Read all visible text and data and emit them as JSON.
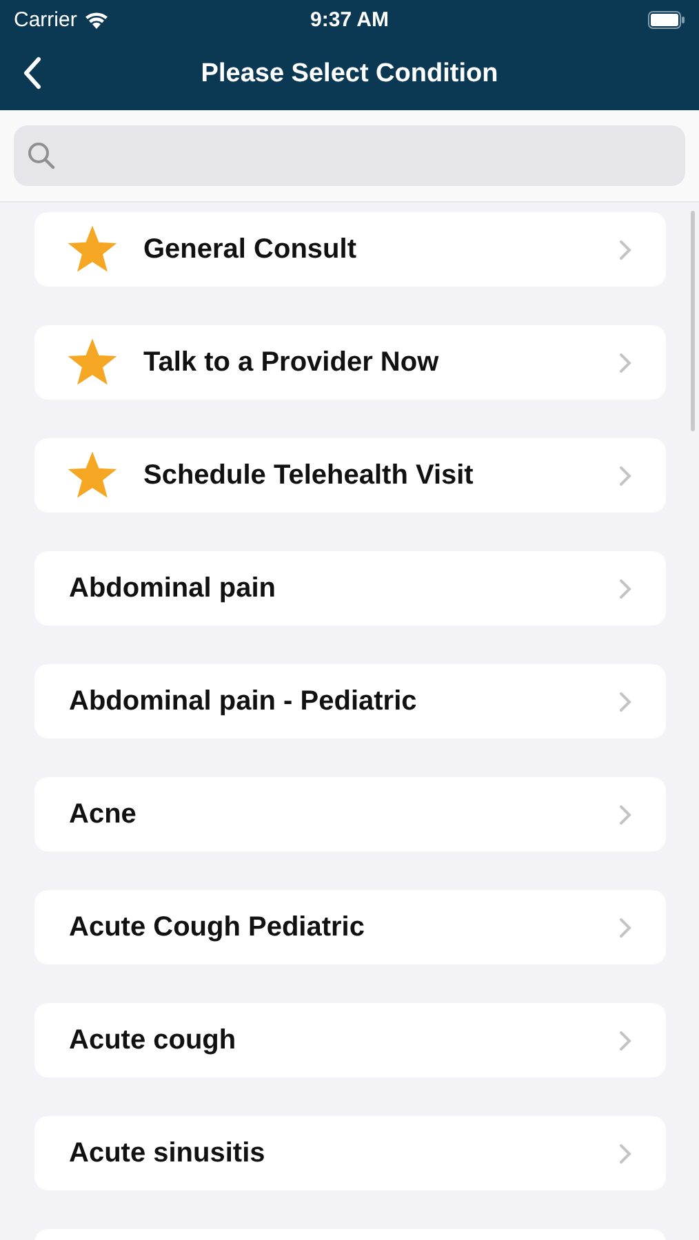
{
  "status_bar": {
    "carrier": "Carrier",
    "time": "9:37 AM"
  },
  "nav": {
    "title": "Please Select Condition"
  },
  "conditions": [
    {
      "label": "General Consult",
      "kind": "featured"
    },
    {
      "label": "Talk to a Provider Now",
      "kind": "featured"
    },
    {
      "label": "Schedule Telehealth Visit",
      "kind": "featured"
    },
    {
      "label": "Abdominal pain",
      "kind": "plain"
    },
    {
      "label": "Abdominal pain - Pediatric",
      "kind": "plain"
    },
    {
      "label": "Acne",
      "kind": "plain"
    },
    {
      "label": "Acute Cough Pediatric",
      "kind": "plain"
    },
    {
      "label": "Acute cough",
      "kind": "plain"
    },
    {
      "label": "Acute sinusitis",
      "kind": "plain"
    }
  ]
}
